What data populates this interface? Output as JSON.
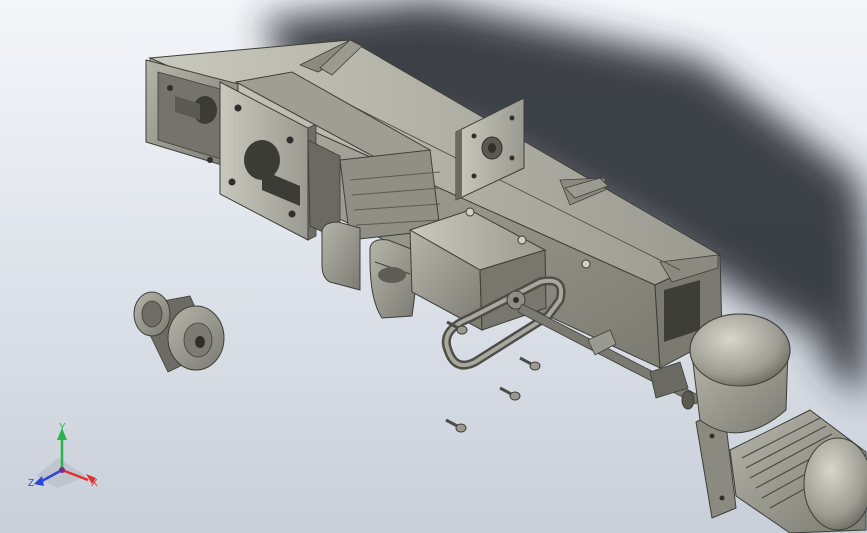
{
  "viewport": {
    "background_top": "#f4f6f9",
    "background_bottom": "#c9cfd9"
  },
  "triad": {
    "x_label": "X",
    "y_label": "Y",
    "z_label": "Z",
    "x_color": "#e0322a",
    "y_color": "#2bb24c",
    "z_color": "#2a47d6"
  },
  "model": {
    "metal_color": "#8d8d84",
    "metal_dark": "#5c5c55",
    "metal_light": "#b6b6ab",
    "components": [
      "frame-rail",
      "end-plate",
      "mount-plate",
      "bearing-block",
      "gearbox",
      "belt-loop",
      "drive-shaft",
      "motor",
      "pulley",
      "bolt"
    ]
  }
}
